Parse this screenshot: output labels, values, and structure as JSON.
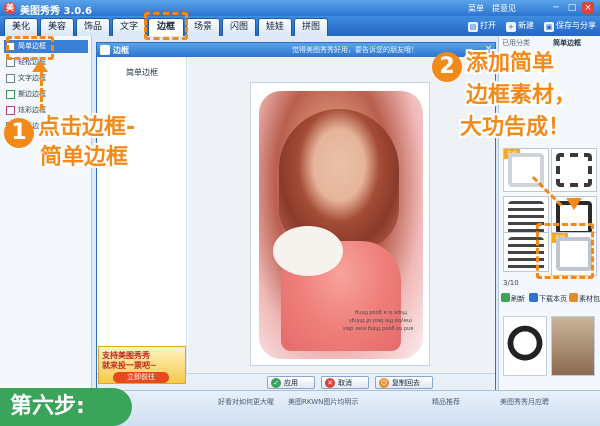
{
  "app": {
    "title": "美图秀秀 3.0.6",
    "logo_glyph": "美",
    "menu_label": "菜单",
    "feedback_label": "提意见",
    "window_buttons": [
      "─",
      "□",
      "×"
    ]
  },
  "tabs": [
    {
      "label": "美化"
    },
    {
      "label": "美容"
    },
    {
      "label": "饰品"
    },
    {
      "label": "文字"
    },
    {
      "label": "边框",
      "active": true
    },
    {
      "label": "场景"
    },
    {
      "label": "闪图"
    },
    {
      "label": "娃娃"
    },
    {
      "label": "拼图"
    }
  ],
  "toolbar": {
    "open_label": "打开",
    "new_label": "新建",
    "save_label": "保存与分享"
  },
  "left_panel": {
    "items": [
      {
        "label": "简单边框",
        "active": true
      },
      {
        "label": "轻松边框"
      },
      {
        "label": "文字边框"
      },
      {
        "label": "撕边边框"
      },
      {
        "label": "炫彩边框"
      },
      {
        "label": "动画边框"
      }
    ]
  },
  "promo": {
    "line1": "支持美图秀秀",
    "line2": "就来投一票吧~",
    "button": "立即前往"
  },
  "dialog": {
    "title": "边框",
    "banner": "觉得美图秀秀好用，要告诉您的朋友哦！",
    "close": "×",
    "side_label": "简单边框",
    "photo_text": [
      "Hope is a good thing",
      "maybe the best of things",
      "and no good thing ever dies"
    ],
    "buttons": {
      "apply": "应用",
      "cancel": "取消",
      "reset": "复制回去"
    }
  },
  "right_panel": {
    "tab1": "已用分类",
    "tab2": "简单边框",
    "tag_label": "在线",
    "page": "3/10",
    "btn_refresh": "刷新",
    "btn_download": "下载本页",
    "btn_material": "素材包"
  },
  "status_bar": {
    "text": "好看对如何更大喔　　美图RKWN图片均明示",
    "right1": "精品推荐",
    "right2": "美图秀秀月应聘"
  },
  "tutorial": {
    "step1_num": "1",
    "step1_text_line1": "点击边框-",
    "step1_text_line2": "简单边框",
    "step2_num": "2",
    "step2_text_line1": "添加简单",
    "step2_text_line2": "边框素材，",
    "step2_text_line3": "大功告成！",
    "step_badge": "第六步:"
  },
  "colors": {
    "accent_orange": "#f28a1a",
    "title_blue": "#2c74cf",
    "badge_green": "#3aa55a"
  }
}
